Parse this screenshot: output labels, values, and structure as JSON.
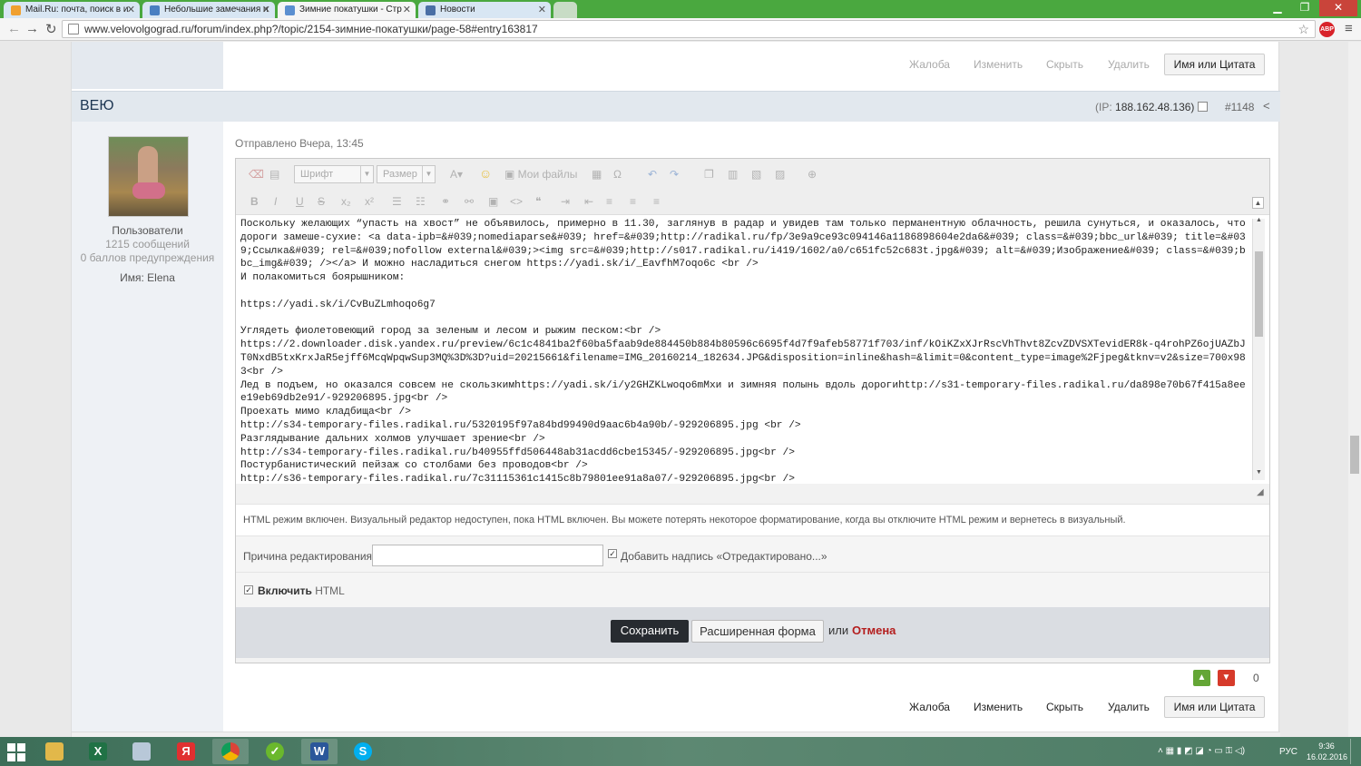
{
  "browser": {
    "tabs": [
      {
        "title": "Mail.Ru: почта, поиск в и",
        "color": "#f0a030"
      },
      {
        "title": "Небольшие замечания и",
        "color": "#4a7fc1"
      },
      {
        "title": "Зимние покатушки - Стр",
        "color": "#5b8fd0"
      },
      {
        "title": "Новости",
        "color": "#4a6fa5"
      }
    ],
    "url": "www.velovolgograd.ru/forum/index.php?/topic/2154-зимние-покатушки/page-58#entry163817",
    "adblock_badge": "ABP"
  },
  "prev_post_actions": {
    "complaint": "Жалоба",
    "edit": "Изменить",
    "hide": "Скрыть",
    "delete": "Удалить",
    "quote": "Имя или Цитата"
  },
  "post": {
    "author": "ВЕЮ",
    "ip_label": "(IP:",
    "ip": "188.162.48.136)",
    "post_number": "#1148",
    "group": "Пользователи",
    "messages": "1215 сообщений",
    "warnings": "0 баллов предупреждения",
    "name_label": "Имя:",
    "name": "Elena",
    "sent": "Отправлено Вчера, 13:45"
  },
  "editor": {
    "font_label": "Шрифт",
    "size_label": "Размер",
    "my_files": "Мои файлы",
    "content": "Поскольку желающих “упасть на хвост” не объявилось, примерно в 11.30, заглянув в радар и увидев там только перманентную облачность, решила сунуться, и оказалось, что дороги замеше-сухие: <a data-ipb=&#039;nomediaparse&#039; href=&#039;http://radikal.ru/fp/3e9a9ce93c094146a1186898604e2da6&#039; class=&#039;bbc_url&#039; title=&#039;Ссылка&#039; rel=&#039;nofollow external&#039;><img src=&#039;http://s017.radikal.ru/i419/1602/a0/c651fc52c683t.jpg&#039; alt=&#039;Изображение&#039; class=&#039;bbc_img&#039; /></a> И можно насладиться снегом https://yadi.sk/i/_EavfhM7oqo6c <br />\nИ полакомиться боярышником:\n\nhttps://yadi.sk/i/CvBuZLmhoqo6g7\n\nУглядеть фиолетовеющий город за зеленым и лесом и рыжим песком:<br />\nhttps://2.downloader.disk.yandex.ru/preview/6c1c4841ba2f60ba5faab9de884450b884b80596c6695f4d7f9afeb58771f703/inf/kOiKZxXJrRscVhThvt8ZcvZDVSXTevidER8k-q4rohPZ6ojUAZbJT0NxdB5txKrxJaR5ejff6McqWpqwSup3MQ%3D%3D?uid=20215661&filename=IMG_20160214_182634.JPG&disposition=inline&hash=&limit=0&content_type=image%2Fjpeg&tknv=v2&size=700x983<br />\nЛед в подъем, но оказался совсем не скользкимhttps://yadi.sk/i/y2GHZKLwoqo6mМхи и зимняя полынь вдоль дорогиhttp://s31-temporary-files.radikal.ru/da898e70b67f415a8eee19eb69db2e91/-929206895.jpg<br />\nПроехать мимо кладбища<br />\nhttp://s34-temporary-files.radikal.ru/5320195f97a84bd99490d9aac6b4a90b/-929206895.jpg <br />\nРазглядывание дальних холмов улучшает зрение<br />\nhttp://s34-temporary-files.radikal.ru/b40955ffd506448ab31acdd6cbe15345/-929206895.jpg<br />\nПостурбанистический пейзаж со столбами без проводов<br />\nhttp://s36-temporary-files.radikal.ru/7c31115361c1415c8b79801ee91a8a07/-929206895.jpg<br />",
    "html_note": "HTML режим включен. Визуальный редактор недоступен, пока HTML включен. Вы можете потерять некоторое форматирование, когда вы отключите HTML режим и вернетесь в визуальный.",
    "reason_label": "Причина редактирования:",
    "reason_value": "",
    "add_edited_label": "Добавить надпись «Отредактировано...»",
    "enable_bold": "Включить",
    "enable_rest": "HTML",
    "save": "Сохранить",
    "extended": "Расширенная форма",
    "or": "или",
    "cancel": "Отмена"
  },
  "rating": {
    "score": "0"
  },
  "post_actions": {
    "complaint": "Жалоба",
    "edit": "Изменить",
    "hide": "Скрыть",
    "delete": "Удалить",
    "quote": "Имя или Цитата"
  },
  "taskbar": {
    "lang": "РУС",
    "time": "9:36",
    "date": "16.02.2016"
  }
}
